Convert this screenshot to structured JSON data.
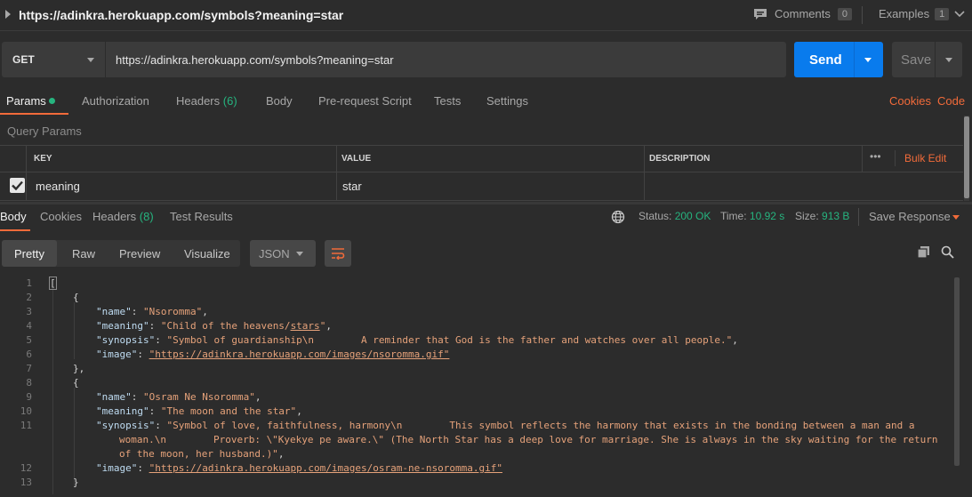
{
  "window": {
    "title": "https://adinkra.herokuapp.com/symbols?meaning=star",
    "comments_label": "Comments",
    "comments_count": "0",
    "examples_label": "Examples",
    "examples_count": "1"
  },
  "request": {
    "method": "GET",
    "url": "https://adinkra.herokuapp.com/symbols?meaning=star",
    "send_label": "Send",
    "save_label": "Save"
  },
  "request_tabs": {
    "params": "Params",
    "authorization": "Authorization",
    "headers": "Headers",
    "headers_count": "(6)",
    "body": "Body",
    "prerequest": "Pre-request Script",
    "tests": "Tests",
    "settings": "Settings",
    "cookies": "Cookies",
    "code": "Code"
  },
  "query_params": {
    "section_label": "Query Params",
    "headers": {
      "key": "KEY",
      "value": "VALUE",
      "description": "DESCRIPTION",
      "more": "•••",
      "bulk_edit": "Bulk Edit"
    },
    "rows": [
      {
        "checked": true,
        "key": "meaning",
        "value": "star",
        "description": ""
      }
    ]
  },
  "response_tabs": {
    "body": "Body",
    "cookies": "Cookies",
    "headers": "Headers",
    "headers_count": "(8)",
    "test_results": "Test Results"
  },
  "response_meta": {
    "status_label": "Status:",
    "status_value": "200 OK",
    "time_label": "Time:",
    "time_value": "10.92 s",
    "size_label": "Size:",
    "size_value": "913 B",
    "save_response": "Save Response"
  },
  "view_modes": {
    "pretty": "Pretty",
    "raw": "Raw",
    "preview": "Preview",
    "visualize": "Visualize",
    "format": "JSON"
  },
  "code_lines": {
    "1": "[",
    "2": "{",
    "3k": "\"name\"",
    "3v": "\"Nsoromma\"",
    "4k": "\"meaning\"",
    "4v1": "\"Child of the heavens/",
    "4u": "stars",
    "4v2": "\"",
    "5k": "\"synopsis\"",
    "5v": "\"Symbol of guardianship\\n        A reminder that God is the father and watches over all people.\"",
    "6k": "\"image\"",
    "6v": "\"https://adinkra.herokuapp.com/images/nsoromma.gif\"",
    "7": "},",
    "8": "{",
    "9k": "\"name\"",
    "9v": "\"Osram Ne Nsoromma\"",
    "10k": "\"meaning\"",
    "10v": "\"The moon and the star\"",
    "11k": "\"synopsis\"",
    "11v": "\"Symbol of love, faithfulness, harmony\\n        This symbol reflects the harmony that exists in the bonding between a man and a",
    "11b": "woman.\\n        Proverb: \\\"Kyekye pe aware.\\\" (The North Star has a deep love for marriage. She is always in the sky waiting for the return",
    "11c": "of the moon, her husband.)\"",
    "12k": "\"image\"",
    "12v": "\"https://adinkra.herokuapp.com/images/osram-ne-nsoromma.gif\"",
    "13": "}"
  },
  "line_numbers": [
    "1",
    "2",
    "3",
    "4",
    "5",
    "6",
    "7",
    "8",
    "9",
    "10",
    "11",
    "12",
    "13"
  ],
  "colors": {
    "accent": "#f26b3a",
    "send": "#097bed",
    "status_ok": "#26b47f"
  }
}
